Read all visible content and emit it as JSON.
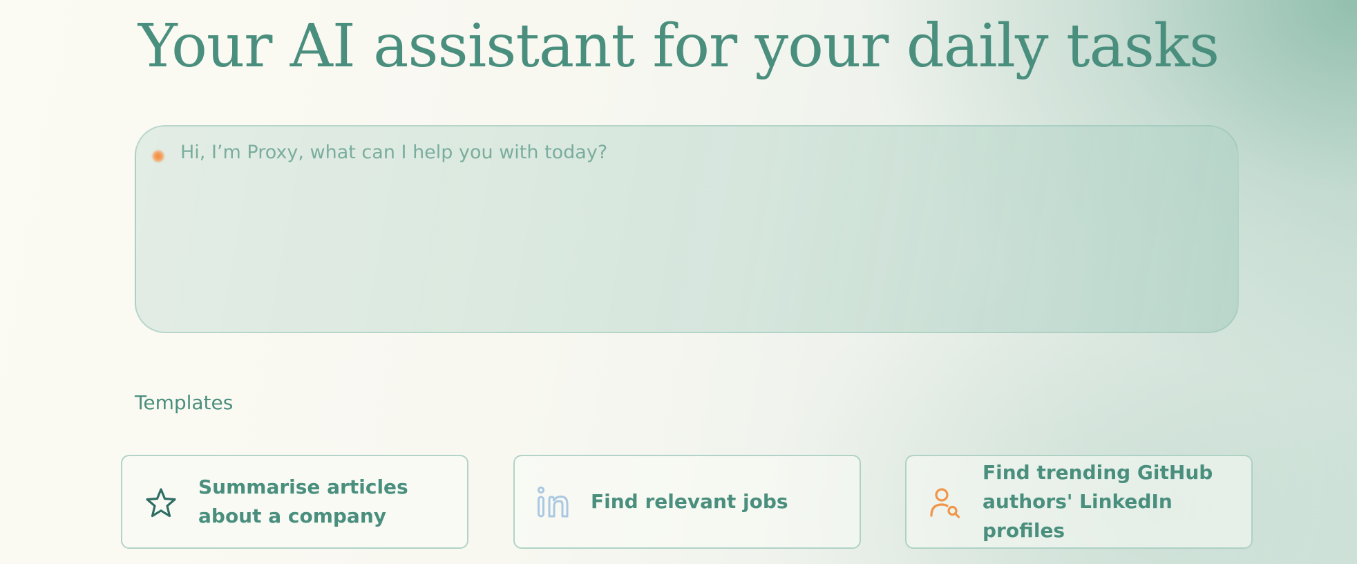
{
  "headline": "Your AI assistant for your daily tasks",
  "prompt": {
    "placeholder": "Hi, I’m Proxy, what can I help you with today?",
    "value": ""
  },
  "templates": {
    "heading": "Templates",
    "items": [
      {
        "label": "Summarise articles about a company",
        "icon": "star-icon"
      },
      {
        "label": "Find relevant jobs",
        "icon": "linkedin-icon"
      },
      {
        "label": "Find trending GitHub authors' LinkedIn profiles",
        "icon": "user-search-icon"
      }
    ]
  },
  "colors": {
    "accent": "#4a8f7e",
    "placeholder": "#7aad9e",
    "orange": "#f0954a",
    "linkedin_blue": "#a9c8e2",
    "star": "#2f6e63"
  }
}
